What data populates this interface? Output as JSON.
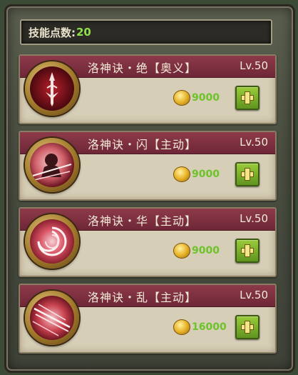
{
  "header": {
    "points_label": "技能点数:",
    "points_value": "20"
  },
  "skills": [
    {
      "name": "洛神诀・绝【奥义】",
      "level": "Lv.50",
      "cost": "9000",
      "icon": "sword-icon"
    },
    {
      "name": "洛神诀・闪【主动】",
      "level": "Lv.50",
      "cost": "9000",
      "icon": "dash-figure-icon"
    },
    {
      "name": "洛神诀・华【主动】",
      "level": "Lv.50",
      "cost": "9000",
      "icon": "swirl-icon"
    },
    {
      "name": "洛神诀・乱【主动】",
      "level": "Lv.50",
      "cost": "16000",
      "icon": "slash-icon"
    }
  ],
  "colors": {
    "header": "#7a2e3e",
    "cost_text": "#6dc32a",
    "points_value": "#8fe04a"
  }
}
